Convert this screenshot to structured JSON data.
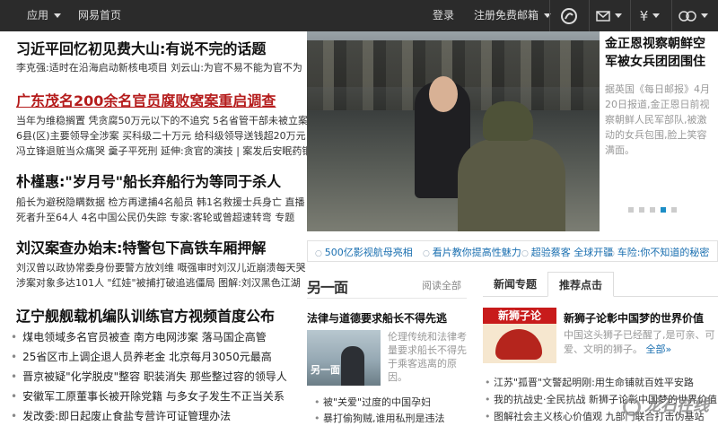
{
  "topbar": {
    "app_menu": "应用",
    "home": "网易首页",
    "login": "登录",
    "register": "注册免费邮箱",
    "icons": [
      "netease-logo-icon",
      "mail-icon",
      "yuan-icon",
      "user-icon"
    ]
  },
  "left": {
    "headlines": [
      {
        "title": "习近平回忆初见费大山:有说不完的话题",
        "subs": [
          "李克强:适时在沿海启动新核电项目 刘云山:为官不易不能为官不为"
        ]
      },
      {
        "title": "广东茂名200余名官员腐败窝案重启调查",
        "subs": [
          "当年为维稳搁置 凭贪腐50万元以下的不追究 5名省管干部未被立案",
          "6县(区)主要领导全涉案 买科级二十万元 给科级领导送钱超20万元",
          "冯立锋退赃当众痛哭 羹子平死刑  延伸:贪官的演技 | 案发后安眠药铜"
        ]
      },
      {
        "title": "朴槿惠:\"岁月号\"船长弃船行为等同于杀人",
        "subs": [
          "船长为避税隐瞒数据 检方再逮捕4名船员 韩1名救援士兵身亡 直播",
          "死者升至64人 4名中国公民仍失踪 专家:客轮或曾超速转弯 专题"
        ]
      },
      {
        "title": "刘汉案查办始末:特警包下高铁车厢押解",
        "subs": [
          "刘汉曾以政协常委身份要警方放刘维 嘅强审时刘汉儿近崩溃每天哭",
          "涉案对象多达101人 \"红娃\"被捕打破追逃僵局 图解:刘汉黑色江湖"
        ]
      },
      {
        "title": "辽宁舰舰载机编队训练官方视频首度公布",
        "subs": []
      }
    ],
    "bullets": [
      "煤电领域多名官员被查  南方电网涉案  落马国企高管",
      "25省区市上调企退人员养老金  北京每月3050元最高",
      "晋京被疑\"化学脱皮\"整容  职装消失  那些整过容的领导人",
      "安徽军工原董事长被开除党籍  与多女子发生不正当关系",
      "发改委:即日起废止食盐专营许可证管理办法"
    ]
  },
  "hero": {
    "title": "金正恩视察朝鲜空军被女兵团团围住",
    "text": "据英国《每日邮报》4月20日报道,金正恩日前视察朝鲜人民军部队,被激动的女兵包围,脸上笑容满面。"
  },
  "links_bar": [
    "500亿影视航母亮相",
    "看片教你提高性魅力",
    "超验蔡客 全球开疆",
    "车险:你不知道的秘密"
  ],
  "lingyimian": {
    "logo": "另一面",
    "more": "阅读全部",
    "title": "法律与道德要求船长不得先逃",
    "img_tag": "另一面",
    "desc": "伦理传统和法律考量要求船长不得先于乘客逃离的原因。",
    "bullets": [
      "被\"关爱\"过度的中国孕妇",
      "暴打偷狗贼,谁用私刑是违法"
    ]
  },
  "tabs": [
    "新闻专题",
    "推荐点击"
  ],
  "recommend": {
    "img_label": "新狮子论",
    "title": "新狮子论彰中国梦的世界价值",
    "desc": "中国这头狮子已经醒了,是可亲、可爱、文明的狮子。",
    "more": "全部»",
    "bullets": [
      "江苏\"孤晋\"文警起明刚:用生命铺就百姓平安路",
      "我的抗战史·全民抗战 新狮子论彰中国梦的世界价值",
      "图解社会主义核心价值观 九部门联合打击伪基站"
    ]
  },
  "watermark": "龙石在线",
  "carousel": {
    "count": 5,
    "active_index": 3
  }
}
